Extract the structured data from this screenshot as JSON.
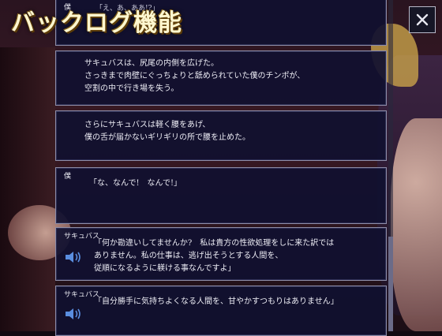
{
  "window": {
    "title": "バックログ機能"
  },
  "close_button": {
    "icon": "close-icon",
    "label": "×"
  },
  "entries": [
    {
      "speaker": "僕",
      "text": "「え、あ、ああ!?」",
      "voice": false
    },
    {
      "speaker": "",
      "text": "サキュバスは、尻尾の内側を広げた。\nさっきまで肉壁にぐっちょりと舐められていた僕のチンポが、\n空割の中で行き場を失う。",
      "voice": false
    },
    {
      "speaker": "",
      "text": "さらにサキュバスは軽く腰をあげ、\n僕の舌が届かないギリギリの所で腰を止めた。",
      "voice": false
    },
    {
      "speaker": "僕",
      "text": "「な、なんで!　なんで!」",
      "voice": false
    },
    {
      "speaker": "サキュバス",
      "text": "「何か勘違いしてませんか?　私は貴方の性欲処理をしに来た訳では\nありません。私の仕事は、逃げ出そうとする人間を、\n従順になるように躾ける事なんですよ」",
      "voice": true
    },
    {
      "speaker": "サキュバス",
      "text": "「自分勝手に気持ちよくなる人間を、甘やかすつもりはありません」",
      "voice": true
    }
  ],
  "colors": {
    "panel": "#101030",
    "border": "#8e8ea8",
    "title": "#fff7d0",
    "voice_icon": "#5a8ee0"
  }
}
